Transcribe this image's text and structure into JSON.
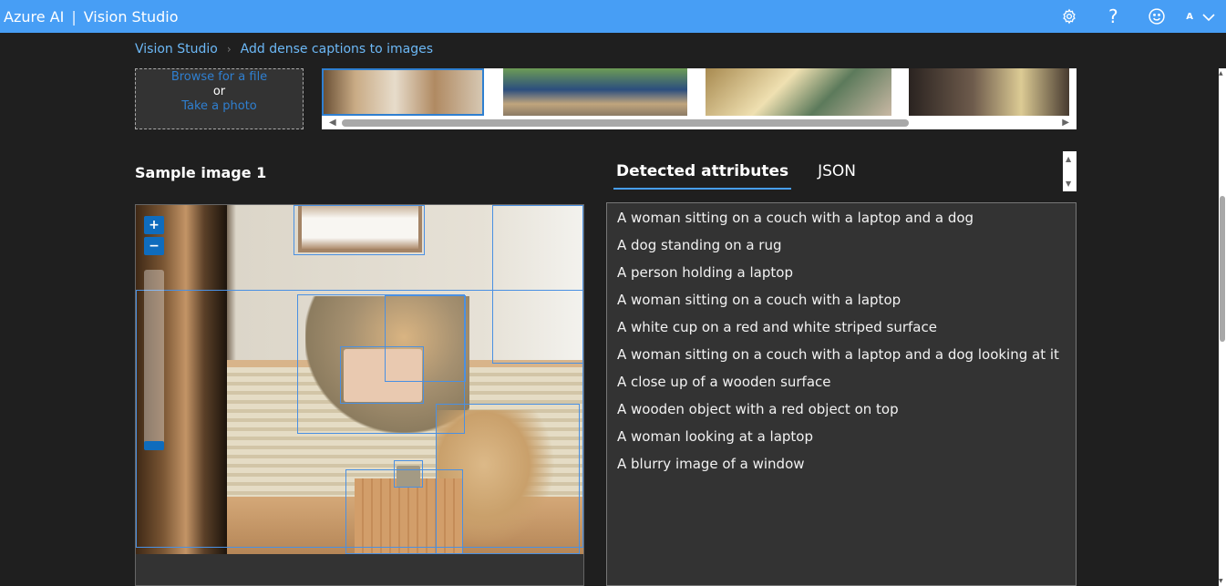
{
  "app": {
    "brand": "Azure AI",
    "separator": "|",
    "product": "Vision Studio",
    "avatar_initial": "A"
  },
  "topbar_icons": [
    "gear-icon",
    "help-icon",
    "feedback-smiley-icon",
    "chevron-down-icon"
  ],
  "breadcrumb": {
    "items": [
      "Vision Studio",
      "Add dense captions to images"
    ]
  },
  "upload": {
    "browse_label": "Browse for a file",
    "or_label": "or",
    "photo_label": "Take a photo"
  },
  "sample": {
    "title": "Sample image 1"
  },
  "zoom": {
    "in_label": "+",
    "out_label": "−"
  },
  "tabs": [
    {
      "label": "Detected attributes",
      "active": true
    },
    {
      "label": "JSON",
      "active": false
    }
  ],
  "attributes": [
    "A woman sitting on a couch with a laptop and a dog",
    "A dog standing on a rug",
    "A person holding a laptop",
    "A woman sitting on a couch with a laptop",
    "A white cup on a red and white striped surface",
    "A woman sitting on a couch with a laptop and a dog looking at it",
    "A close up of a wooden surface",
    "A wooden object with a red object on top",
    "A woman looking at a laptop",
    "A blurry image of a window"
  ],
  "colors": {
    "accent": "#479ef5",
    "link": "#2f7fd0",
    "bbox": "#4a90e2",
    "background": "#1f1f1f",
    "panel": "#333333"
  }
}
